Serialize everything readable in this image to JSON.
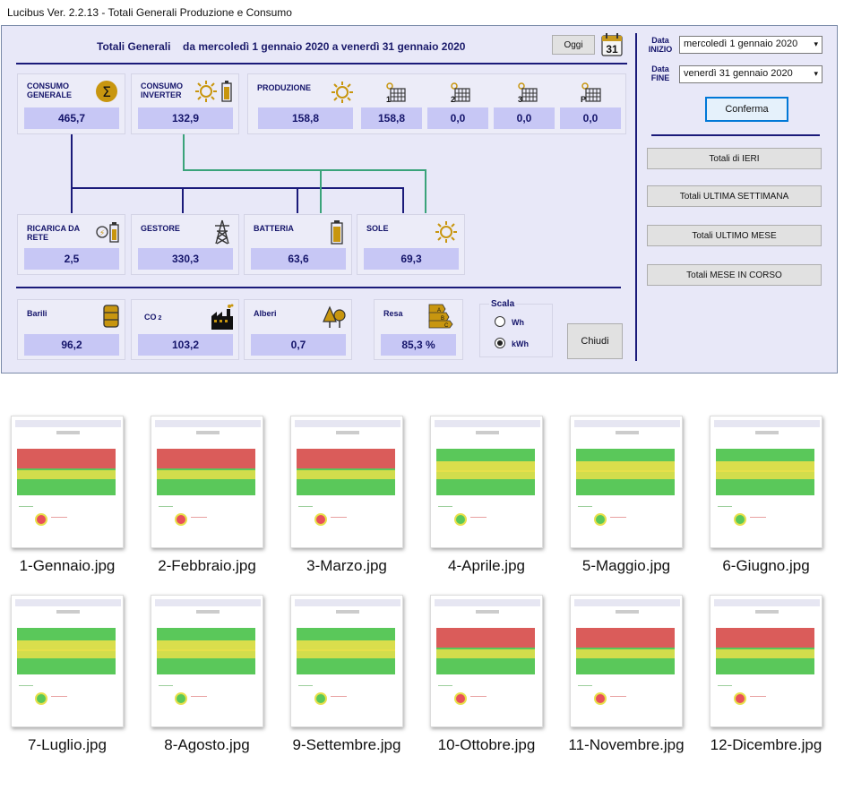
{
  "window": {
    "title": "Lucibus Ver. 2.2.13 -  Totali Generali Produzione e Consumo"
  },
  "header": {
    "label": "Totali Generali",
    "range": "da mercoledì 1 gennaio 2020 a venerdì 31 gennaio 2020",
    "today_button": "Oggi",
    "calendar_day": "31"
  },
  "panels": {
    "consumo_generale": {
      "label1": "CONSUMO",
      "label2": "GENERALE",
      "value": "465,7"
    },
    "consumo_inverter": {
      "label1": "CONSUMO",
      "label2": "INVERTER",
      "value": "132,9"
    },
    "produzione": {
      "label": "PRODUZIONE",
      "value": "158,8",
      "strings": [
        {
          "tag": "1",
          "value": "158,8"
        },
        {
          "tag": "2",
          "value": "0,0"
        },
        {
          "tag": "3",
          "value": "0,0"
        },
        {
          "tag": "P",
          "value": "0,0"
        }
      ]
    },
    "ricarica_rete": {
      "label1": "RICARICA DA",
      "label2": "RETE",
      "value": "2,5"
    },
    "gestore": {
      "label": "GESTORE",
      "value": "330,3"
    },
    "batteria": {
      "label": "BATTERIA",
      "value": "63,6"
    },
    "sole": {
      "label": "SOLE",
      "value": "69,3"
    },
    "barili": {
      "label": "Barili",
      "value": "96,2"
    },
    "co2": {
      "label": "CO",
      "sub": "2",
      "value": "103,2"
    },
    "alberi": {
      "label": "Alberi",
      "value": "0,7"
    },
    "resa": {
      "label": "Resa",
      "value": "85,3 %"
    }
  },
  "scala": {
    "title": "Scala",
    "options": [
      "Wh",
      "kWh"
    ],
    "selected": "kWh"
  },
  "close_button": "Chiudi",
  "right": {
    "inizio_label1": "Data",
    "inizio_label2": "INIZIO",
    "inizio_value": "mercoledì   1  gennaio  2020",
    "fine_label1": "Data",
    "fine_label2": "FINE",
    "fine_value": "venerdì  31  gennaio  2020",
    "confirm": "Conferma",
    "quick": [
      "Totali di IERI",
      "Totali ULTIMA SETTIMANA",
      "Totali ULTIMO MESE",
      "Totali MESE IN CORSO"
    ]
  },
  "files": [
    {
      "name": "1-Gennaio.jpg",
      "accent": "#e8505a"
    },
    {
      "name": "2-Febbraio.jpg",
      "accent": "#e8505a"
    },
    {
      "name": "3-Marzo.jpg",
      "accent": "#e8505a"
    },
    {
      "name": "4-Aprile.jpg",
      "accent": "#5ac85a"
    },
    {
      "name": "5-Maggio.jpg",
      "accent": "#5ac85a"
    },
    {
      "name": "6-Giugno.jpg",
      "accent": "#5ac85a"
    },
    {
      "name": "7-Luglio.jpg",
      "accent": "#5ac85a"
    },
    {
      "name": "8-Agosto.jpg",
      "accent": "#5ac85a"
    },
    {
      "name": "9-Settembre.jpg",
      "accent": "#5ac85a"
    },
    {
      "name": "10-Ottobre.jpg",
      "accent": "#e8505a"
    },
    {
      "name": "11-Novembre.jpg",
      "accent": "#e8505a"
    },
    {
      "name": "12-Dicembre.jpg",
      "accent": "#e8505a"
    }
  ]
}
